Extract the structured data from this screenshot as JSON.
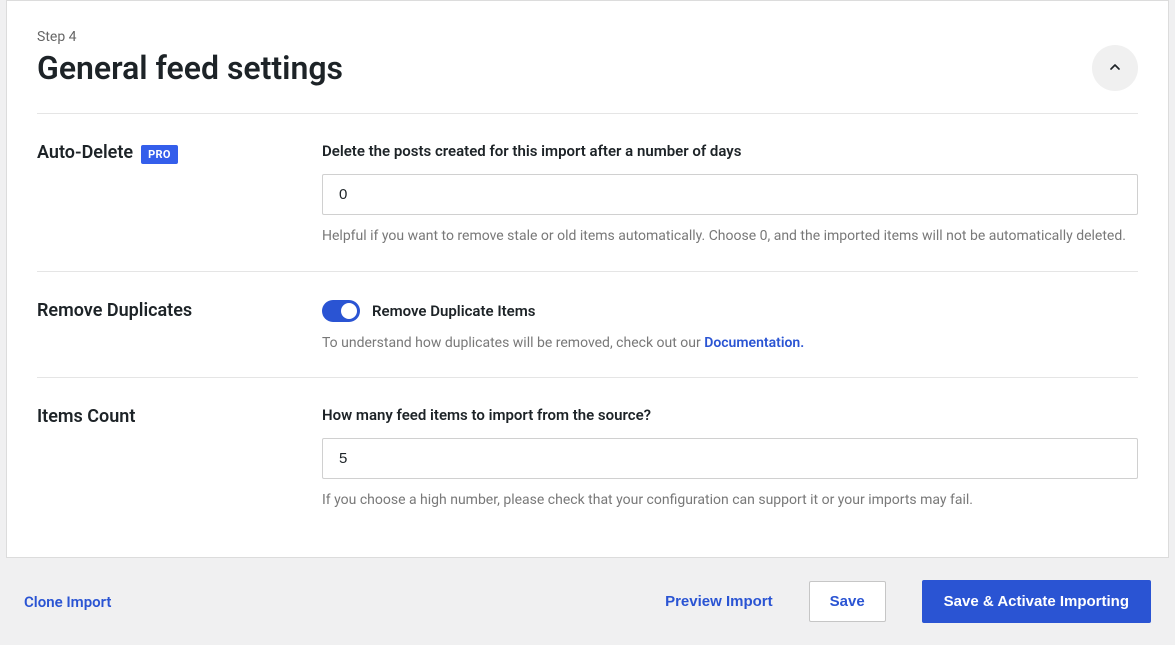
{
  "header": {
    "step_label": "Step 4",
    "title": "General feed settings"
  },
  "auto_delete": {
    "label": "Auto-Delete",
    "badge": "PRO",
    "field_label": "Delete the posts created for this import after a number of days",
    "value": "0",
    "help": "Helpful if you want to remove stale or old items automatically. Choose 0, and the imported items will not be automatically deleted."
  },
  "remove_duplicates": {
    "label": "Remove Duplicates",
    "toggle_label": "Remove Duplicate Items",
    "toggle_on": true,
    "help_prefix": "To understand how duplicates will be removed, check out our ",
    "help_link": "Documentation."
  },
  "items_count": {
    "label": "Items Count",
    "field_label": "How many feed items to import from the source?",
    "value": "5",
    "help": "If you choose a high number, please check that your configuration can support it or your imports may fail."
  },
  "footer": {
    "clone": "Clone Import",
    "preview": "Preview Import",
    "save": "Save",
    "save_activate": "Save & Activate Importing"
  }
}
